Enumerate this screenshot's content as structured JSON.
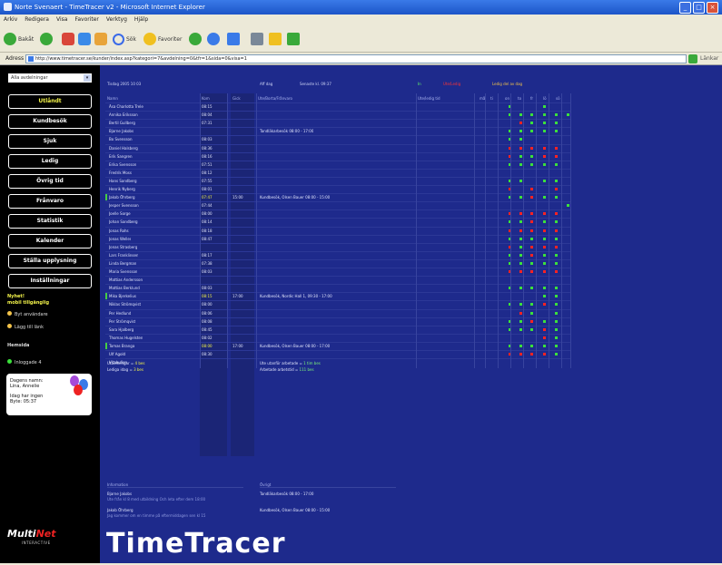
{
  "window": {
    "title": "Norte Svenaert - TimeTracer v2 - Microsoft Internet Explorer"
  },
  "menu": [
    "Arkiv",
    "Redigera",
    "Visa",
    "Favoriter",
    "Verktyg",
    "Hjälp"
  ],
  "toolbar": {
    "back": "Bakåt",
    "search": "Sök",
    "favorites": "Favoriter"
  },
  "address": {
    "label": "Adress",
    "url": "http://www.timetracer.se/kunder/index.asp?kategori=7&avdelning=0&tfr=1&sida=0&visa=1",
    "go": "Gå till",
    "links": "Länkar"
  },
  "sidebar": {
    "dropdown": "Alla avdelningar",
    "nav": [
      "Utlåndt",
      "Kundbesök",
      "Sjuk",
      "Ledig",
      "Övrig tid",
      "Frånvaro",
      "Statistik",
      "Kalender",
      "Ställa upplysning",
      "Inställningar"
    ],
    "promo": [
      "Nyhet!",
      "mobil tillgänglig"
    ],
    "links": [
      "Byt användare",
      "Lägg till länk"
    ],
    "section": "Hemsida",
    "online": "Inloggade 4",
    "info": {
      "l1": "Dagens namn:",
      "l2": "Lina, Annelie",
      "l3": "Idag har ingen",
      "l4": "Byte: 05:37"
    },
    "logo": {
      "brand_a": "Multi",
      "brand_b": "Net",
      "sub": "INTERACTIVE"
    }
  },
  "header": {
    "date": "Tisdag 2005 10 03",
    "week": "Aff dag",
    "time": "Senaste kl. 09:37",
    "legend": [
      "In",
      "Ute/Ledig",
      "Ledig del av dag"
    ]
  },
  "columns": [
    "Namn",
    "Kom",
    "Gick",
    "Ute/Borta/Frånvaro",
    "Ute/ledig tid",
    "må",
    "ti",
    "on",
    "to",
    "fr",
    "lö",
    "sö"
  ],
  "rows": [
    {
      "name": "Åsa Charlotta Trele",
      "in": "08:15",
      "out": "",
      "note": "",
      "marks": "g--g--"
    },
    {
      "name": "Annika Eriksson",
      "in": "08:04",
      "out": "",
      "note": "",
      "marks": "gggggg"
    },
    {
      "name": "Bertil Gullberg",
      "in": "07:31",
      "out": "",
      "note": "",
      "marks": "-rggg-"
    },
    {
      "name": "Bjarne Jakobs",
      "in": "",
      "out": "",
      "note": "Tandläkarbesök 08:00 - 17:00",
      "marks": "ggggg-"
    },
    {
      "name": "Bo Svensson",
      "in": "08:03",
      "out": "",
      "note": "",
      "marks": "gg----"
    },
    {
      "name": "Daniel Halsberg",
      "in": "08:36",
      "out": "",
      "note": "",
      "marks": "rrrrr-"
    },
    {
      "name": "Erik Sangren",
      "in": "08:16",
      "out": "",
      "note": "",
      "marks": "rggrr-"
    },
    {
      "name": "Erika Svensson",
      "in": "07:51",
      "out": "",
      "note": "",
      "marks": "ggggg-"
    },
    {
      "name": "Fredrik Moss",
      "in": "08:12",
      "out": "",
      "note": "",
      "marks": "------"
    },
    {
      "name": "Hans Sandberg",
      "in": "07:55",
      "out": "",
      "note": "",
      "marks": "gg-gg-"
    },
    {
      "name": "Henrik Nyberg",
      "in": "08:01",
      "out": "",
      "note": "",
      "marks": "r-r-r-"
    },
    {
      "name": "Jakob Öhrberg",
      "in": "07:47",
      "out": "15:00",
      "note": "Kundbesök, Olsen Bauer 08:00 - 15:00",
      "marks": "ggrgg-"
    },
    {
      "name": "Jesper Svensson",
      "in": "07:44",
      "out": "",
      "note": "",
      "marks": "-----g"
    },
    {
      "name": "Joelle Sorge",
      "in": "08:00",
      "out": "",
      "note": "",
      "marks": "rrrrr-"
    },
    {
      "name": "Johan Sandberg",
      "in": "08:14",
      "out": "",
      "note": "",
      "marks": "ggrgg-"
    },
    {
      "name": "Jonas Rohs",
      "in": "08:18",
      "out": "",
      "note": "",
      "marks": "rrrrr-"
    },
    {
      "name": "Jonas Weller",
      "in": "08:47",
      "out": "",
      "note": "",
      "marks": "ggggg-"
    },
    {
      "name": "Jonas Strasberg",
      "in": "",
      "out": "",
      "note": "",
      "marks": "rgrrr-"
    },
    {
      "name": "Lars Franklinsen",
      "in": "08:17",
      "out": "",
      "note": "",
      "marks": "ggrgg-"
    },
    {
      "name": "Linda Bergman",
      "in": "07:38",
      "out": "",
      "note": "",
      "marks": "ggggg-"
    },
    {
      "name": "Maria Svensson",
      "in": "08:03",
      "out": "",
      "note": "",
      "marks": "rrrrr-"
    },
    {
      "name": "Mattias Andersson",
      "in": "",
      "out": "",
      "note": "",
      "marks": "------"
    },
    {
      "name": "Mattias Berklund",
      "in": "08:03",
      "out": "",
      "note": "",
      "marks": "ggggg-"
    },
    {
      "name": "Mika Bjerkelius",
      "in": "08:15",
      "out": "17:00",
      "note": "Kundbesök, Nordic Hall 1, 09:30 - 17:00",
      "marks": "---gg-"
    },
    {
      "name": "Niklas Strömqvist",
      "in": "08:00",
      "out": "",
      "note": "",
      "marks": "gggrg-"
    },
    {
      "name": "Per Hedlund",
      "in": "08:06",
      "out": "",
      "note": "",
      "marks": "-rg-g-"
    },
    {
      "name": "Per Strömqvist",
      "in": "08:08",
      "out": "",
      "note": "",
      "marks": "ggrgg-"
    },
    {
      "name": "Sara Hjalberg",
      "in": "08:45",
      "out": "",
      "note": "",
      "marks": "gggrg-"
    },
    {
      "name": "Thomas Hugelsten",
      "in": "08:02",
      "out": "",
      "note": "",
      "marks": "---rg-"
    },
    {
      "name": "Tomas Branga",
      "in": "08:00",
      "out": "17:00",
      "note": "Kundbesök, Olsen Bauer 08:00 - 17:00",
      "marks": "ggggg-"
    },
    {
      "name": "Ulf Agold",
      "in": "08:30",
      "out": "",
      "note": "",
      "marks": "rrrrg-"
    },
    {
      "name": "Vitabullen",
      "in": "",
      "out": "",
      "note": "",
      "marks": "------"
    }
  ],
  "summary": {
    "left": [
      {
        "label": "Utbildningar = ",
        "value": "4 bes"
      },
      {
        "label": "Lediga idag = ",
        "value": "3 bes"
      }
    ],
    "right": [
      {
        "label": "Ute utanför arbetade = ",
        "value": "1 tim bes"
      },
      {
        "label": "Arbetade arbetstid = ",
        "value": "111 bes"
      }
    ]
  },
  "info_section": {
    "title": "Information",
    "items": [
      {
        "name": "Bjarne Jakobs",
        "text": "Ute från kl 8 med utbildning Och leta efter dem 18:00"
      },
      {
        "name": "Jakob Öhrberg",
        "text": "Jag kommer om en timme på eftermiddagen sen kl 15"
      }
    ]
  },
  "other_section": {
    "title": "Övrigt",
    "items": [
      "Tandläkarbesök 08:00 - 17:00",
      "Kundbesök, Olsen Bauer 08:00 - 15:00"
    ]
  },
  "brand": "TimeTracer"
}
